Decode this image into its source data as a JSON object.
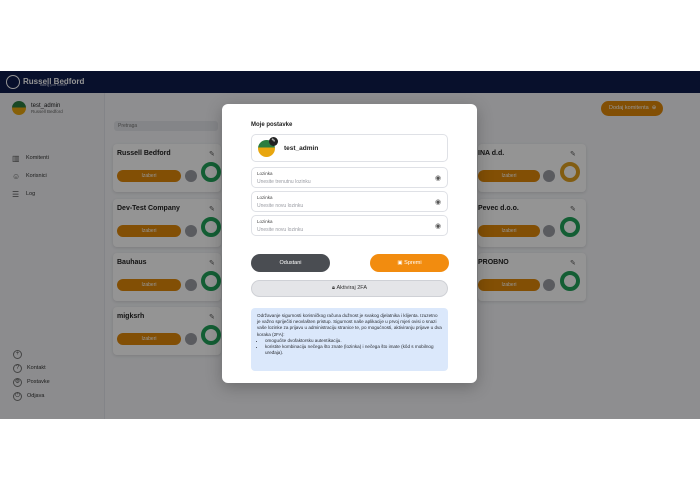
{
  "app": {
    "brand": "Russell Bedford",
    "tagline": "taking you further"
  },
  "sidebar": {
    "user": {
      "name": "test_admin",
      "company": "Russell Bedford"
    },
    "items": [
      {
        "label": "Komitenti",
        "icon": "building-icon"
      },
      {
        "label": "Korisnici",
        "icon": "user-icon"
      },
      {
        "label": "Log",
        "icon": "list-icon"
      }
    ],
    "bottom": [
      {
        "label": "",
        "icon": "plus-circle-icon"
      },
      {
        "label": "Kontakt",
        "icon": "help-icon"
      },
      {
        "label": "Postavke",
        "icon": "gear-icon"
      },
      {
        "label": "Odjava",
        "icon": "logout-icon"
      }
    ]
  },
  "main": {
    "search_placeholder": "Pretraga",
    "add_button": "Dodaj komitenta",
    "select_label": "Izaberi",
    "cards_left": [
      {
        "name": "Russell Bedford"
      },
      {
        "name": "Dev-Test Company"
      },
      {
        "name": "Bauhaus"
      },
      {
        "name": "migksrh"
      }
    ],
    "cards_right": [
      {
        "name": "INA d.d."
      },
      {
        "name": "Pevec d.o.o."
      },
      {
        "name": "PROBNO"
      }
    ]
  },
  "modal": {
    "title": "Moje postavke",
    "username": "test_admin",
    "fields": [
      {
        "label": "Lozinka",
        "placeholder": "Unesite trenutnu lozinku"
      },
      {
        "label": "Lozinka",
        "placeholder": "Unesite novu lozinku"
      },
      {
        "label": "Lozinka",
        "placeholder": "Unesite novu lozinku"
      }
    ],
    "cancel": "Odustani",
    "save": "Spremi",
    "enable_2fa": "Aktiviraj 2FA",
    "info": {
      "text": "Održavanje sigurnosti korisničkog računa dužnost je svakog djelatnika i klijenta. Izuzetno je važno spriječiti neovlašten pristup. Sigurnost naše aplikacije u prvoj mjeri ovisi o snazi vaše lozinke za prijavu u administraciju stranice te, po mogućnosti, aktiviranju prijave u dva koraka (2FA):",
      "bullets": [
        "omogućite dvofaktorsku autentikaciju.",
        "koristite kombinaciju nečega što znate (lozinka) i nečega što imate (kôd s mobilnog uređaja)."
      ]
    }
  }
}
